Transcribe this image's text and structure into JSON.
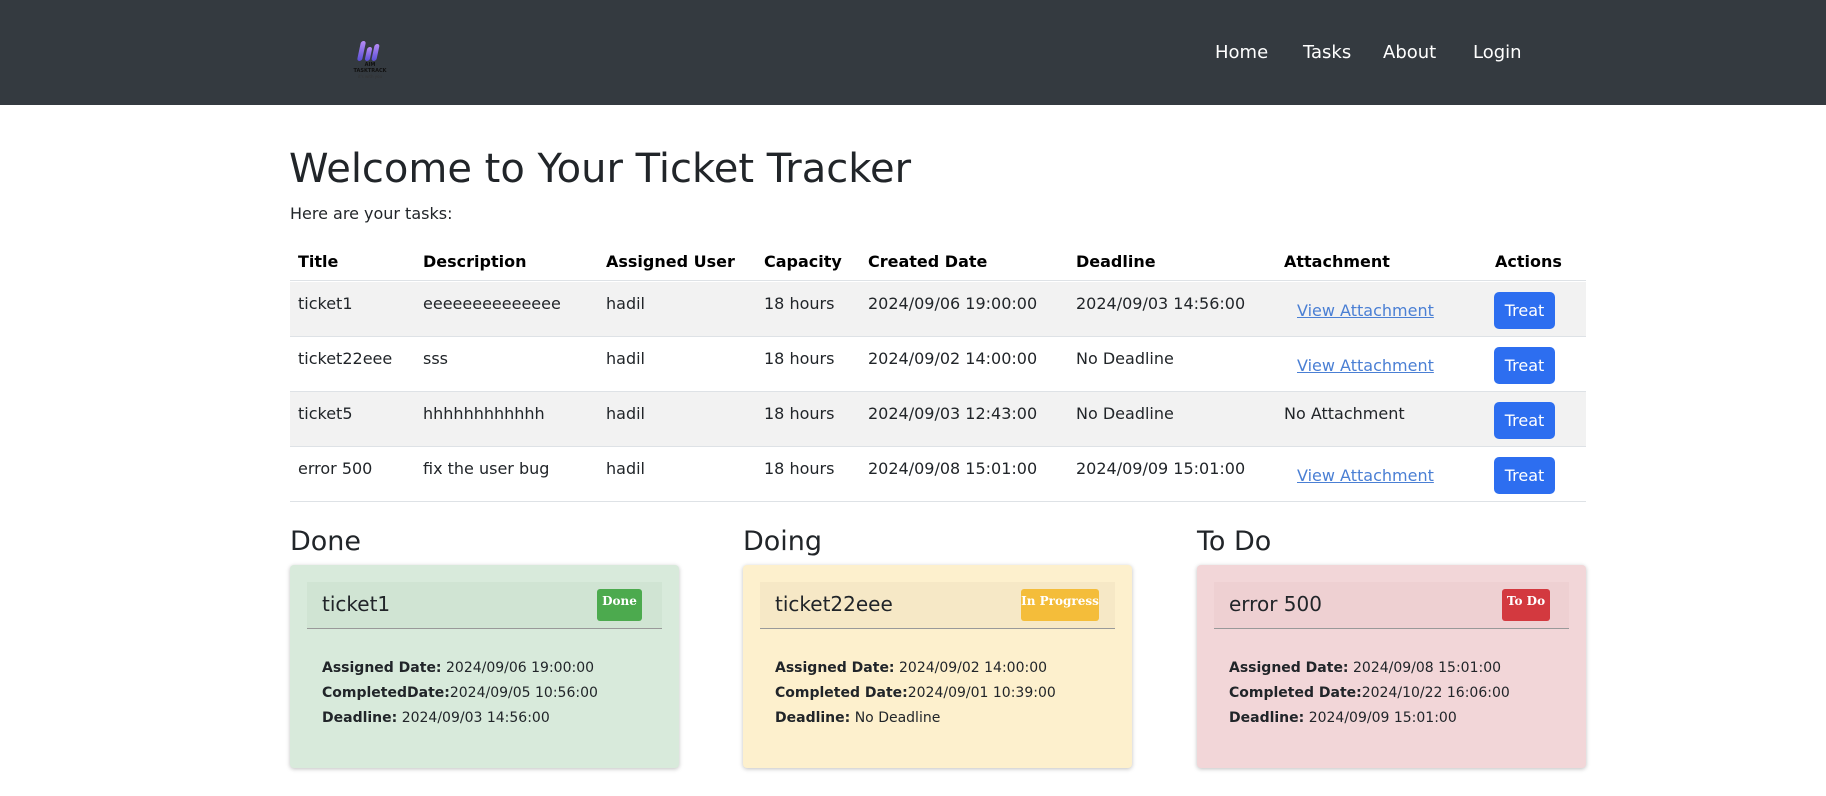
{
  "brand": {
    "logo_line1": "AIM",
    "logo_line2": "TASKTRACK",
    "logo_line3": "it's with you"
  },
  "nav": {
    "items": [
      "Home",
      "Tasks",
      "About",
      "Login"
    ]
  },
  "header": {
    "title": "Welcome to Your Ticket Tracker",
    "subtitle": "Here are your tasks:"
  },
  "table": {
    "columns": [
      "Title",
      "Description",
      "Assigned User",
      "Capacity",
      "Created Date",
      "Deadline",
      "Attachment",
      "Actions"
    ],
    "rows": [
      {
        "title": "ticket1",
        "description": "eeeeeeeeeeeeee",
        "user": "hadil",
        "capacity": "18 hours",
        "created": "2024/09/06 19:00:00",
        "deadline": "2024/09/03 14:56:00",
        "attachment": "View Attachment",
        "action": "Treat"
      },
      {
        "title": "ticket22eee",
        "description": "sss",
        "user": "hadil",
        "capacity": "18 hours",
        "created": "2024/09/02 14:00:00",
        "deadline": "No Deadline",
        "attachment": "View Attachment",
        "action": "Treat"
      },
      {
        "title": "ticket5",
        "description": "hhhhhhhhhhhh",
        "user": "hadil",
        "capacity": "18 hours",
        "created": "2024/09/03 12:43:00",
        "deadline": "No Deadline",
        "attachment": "No Attachment",
        "action": "Treat"
      },
      {
        "title": "error 500",
        "description": "fix the user bug",
        "user": "hadil",
        "capacity": "18 hours",
        "created": "2024/09/08 15:01:00",
        "deadline": "2024/09/09 15:01:00",
        "attachment": "View Attachment",
        "action": "Treat"
      }
    ]
  },
  "columns": {
    "done": {
      "heading": "Done",
      "card_title": "ticket1",
      "badge": "Done",
      "assigned_label": "Assigned Date:",
      "assigned_value": "2024/09/06 19:00:00",
      "completed_label": "CompletedDate:",
      "completed_value": "2024/09/05 10:56:00",
      "deadline_label": "Deadline:",
      "deadline_value": "2024/09/03 14:56:00"
    },
    "doing": {
      "heading": "Doing",
      "card_title": "ticket22eee",
      "badge": "In Progress",
      "assigned_label": "Assigned Date:",
      "assigned_value": "2024/09/02 14:00:00",
      "completed_label": "Completed Date:",
      "completed_value": "2024/09/01 10:39:00",
      "deadline_label": "Deadline:",
      "deadline_value": "No Deadline"
    },
    "todo": {
      "heading": "To Do",
      "card_title": "error 500",
      "badge": "To Do",
      "assigned_label": "Assigned Date:",
      "assigned_value": "2024/09/08 15:01:00",
      "completed_label": "Completed Date:",
      "completed_value": "2024/10/22 16:06:00",
      "deadline_label": "Deadline:",
      "deadline_value": "2024/09/09 15:01:00"
    }
  },
  "colors": {
    "navbar": "#343a40",
    "primary_button": "#2d6ef0",
    "done_card": "#d8eadb",
    "done_header": "#d0e4d3",
    "done_badge": "#4caa4e",
    "doing_card": "#fdf0cd",
    "doing_header": "#f6e8c6",
    "doing_badge": "#f4bd3a",
    "todo_card": "#f2d6d8",
    "todo_header": "#eed0d2",
    "todo_badge": "#d3393f"
  }
}
